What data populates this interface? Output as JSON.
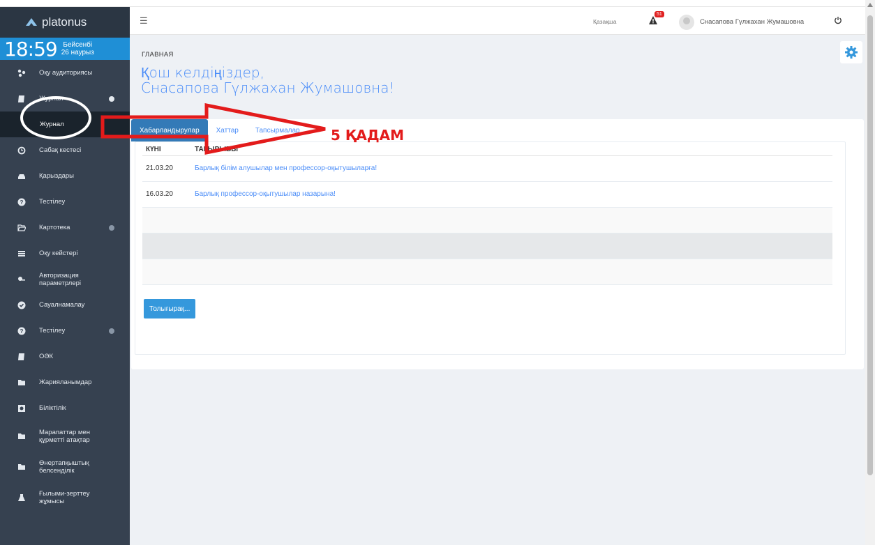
{
  "app": {
    "brand": "platonus"
  },
  "clock": {
    "time": "18:59",
    "weekday": "Бейсенбі",
    "date": "26 наурыз"
  },
  "sidebar": {
    "items": [
      {
        "label": "Оқу аудиториясы",
        "icon": "sitemap-icon"
      },
      {
        "label": "Журнал",
        "icon": "book-icon",
        "expanded": true
      },
      {
        "label": "Сабақ кестесі",
        "icon": "clock-icon"
      },
      {
        "label": "Қарыздары",
        "icon": "drive-icon"
      },
      {
        "label": "Тестілеу",
        "icon": "question-icon"
      },
      {
        "label": "Картотека",
        "icon": "folder-open-icon"
      },
      {
        "label": "Оқу кейстері",
        "icon": "list-icon"
      },
      {
        "label": "Авторизация параметрлері",
        "icon": "key-icon"
      },
      {
        "label": "Сауалнамалау",
        "icon": "check-circle-icon"
      },
      {
        "label": "Тестілеу",
        "icon": "question-icon"
      },
      {
        "label": "ОӘК",
        "icon": "book-icon"
      },
      {
        "label": "Жарияланымдар",
        "icon": "folder-icon"
      },
      {
        "label": "Біліктілік",
        "icon": "certificate-icon"
      },
      {
        "label": "Марапаттар мен құрметті атақтар",
        "icon": "folder-icon"
      },
      {
        "label": "Өнертапқыштық белсенділік",
        "icon": "folder-icon"
      },
      {
        "label": "Ғылыми-зерттеу жұмысы",
        "icon": "flask-icon"
      }
    ],
    "sub_item": "Журнал"
  },
  "header": {
    "language": "Қазақша",
    "notification_count": "51",
    "user_name": "Снасапова Гүлжахан Жумашовна"
  },
  "page": {
    "breadcrumb": "ГЛАВНАЯ",
    "welcome_line1": "Қош келдіңіздер,",
    "welcome_line2": "Снасапова Гүлжахан Жумашовна!"
  },
  "tabs": [
    "Хабарландырулар",
    "Хаттар",
    "Тапсырмалар"
  ],
  "table": {
    "headers": [
      "КҮНІ",
      "ТАҚЫРЫБЫ"
    ],
    "rows": [
      {
        "date": "21.03.20",
        "topic": "Барлық білім алушылар мен профессор-оқытушыларға!"
      },
      {
        "date": "16.03.20",
        "topic": "Барлық профессор-оқытушылар назарына!"
      }
    ]
  },
  "more_button": "Толығырақ...",
  "annotation": {
    "step_text": "5 ҚАДАМ",
    "color": "#e31b1b"
  }
}
